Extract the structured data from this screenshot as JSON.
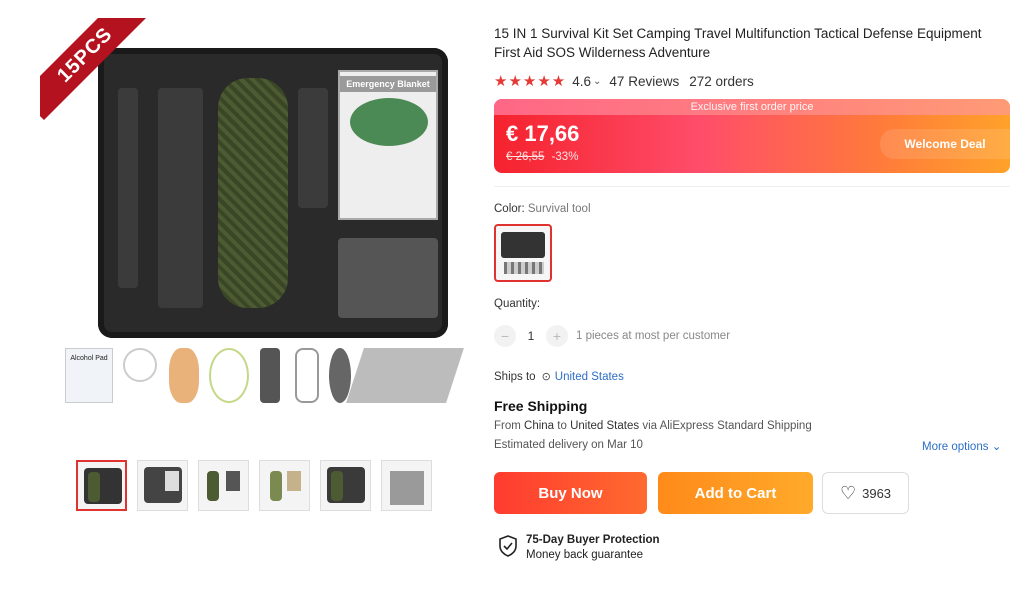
{
  "gallery": {
    "badge": "15PCS",
    "blanket_label": "Emergency Blanket",
    "accessory_label": "Alcohol Pad",
    "thumbnail_count": 6
  },
  "product": {
    "title": "15 IN 1 Survival Kit Set Camping Travel Multifunction Tactical Defense Equipment First Aid SOS Wilderness Adventure",
    "stars": "★★★★★",
    "rating": "4.6",
    "reviews": "47 Reviews",
    "orders": "272 orders"
  },
  "price": {
    "banner": "Exclusive first order price",
    "current": "€ 17,66",
    "original": "€ 26,55",
    "discount": "-33%",
    "deal_label": "Welcome Deal"
  },
  "variant": {
    "label": "Color: ",
    "value": "Survival tool"
  },
  "quantity": {
    "label": "Quantity:",
    "value": "1",
    "minus": "−",
    "plus": "+",
    "note": "1 pieces at most per customer"
  },
  "shipping": {
    "ships_to_label": "Ships to",
    "destination": "United States",
    "headline": "Free Shipping",
    "from_prefix": "From ",
    "origin": "China",
    "to_word": " to ",
    "to_country": "United States",
    "via": " via AliExpress Standard Shipping",
    "delivery": "Estimated delivery on Mar 10",
    "more_options": "More options"
  },
  "actions": {
    "buy_now": "Buy Now",
    "add_to_cart": "Add to Cart",
    "wishlist_count": "3963"
  },
  "protection": {
    "title": "75-Day Buyer Protection",
    "subtitle": "Money back guarantee"
  }
}
